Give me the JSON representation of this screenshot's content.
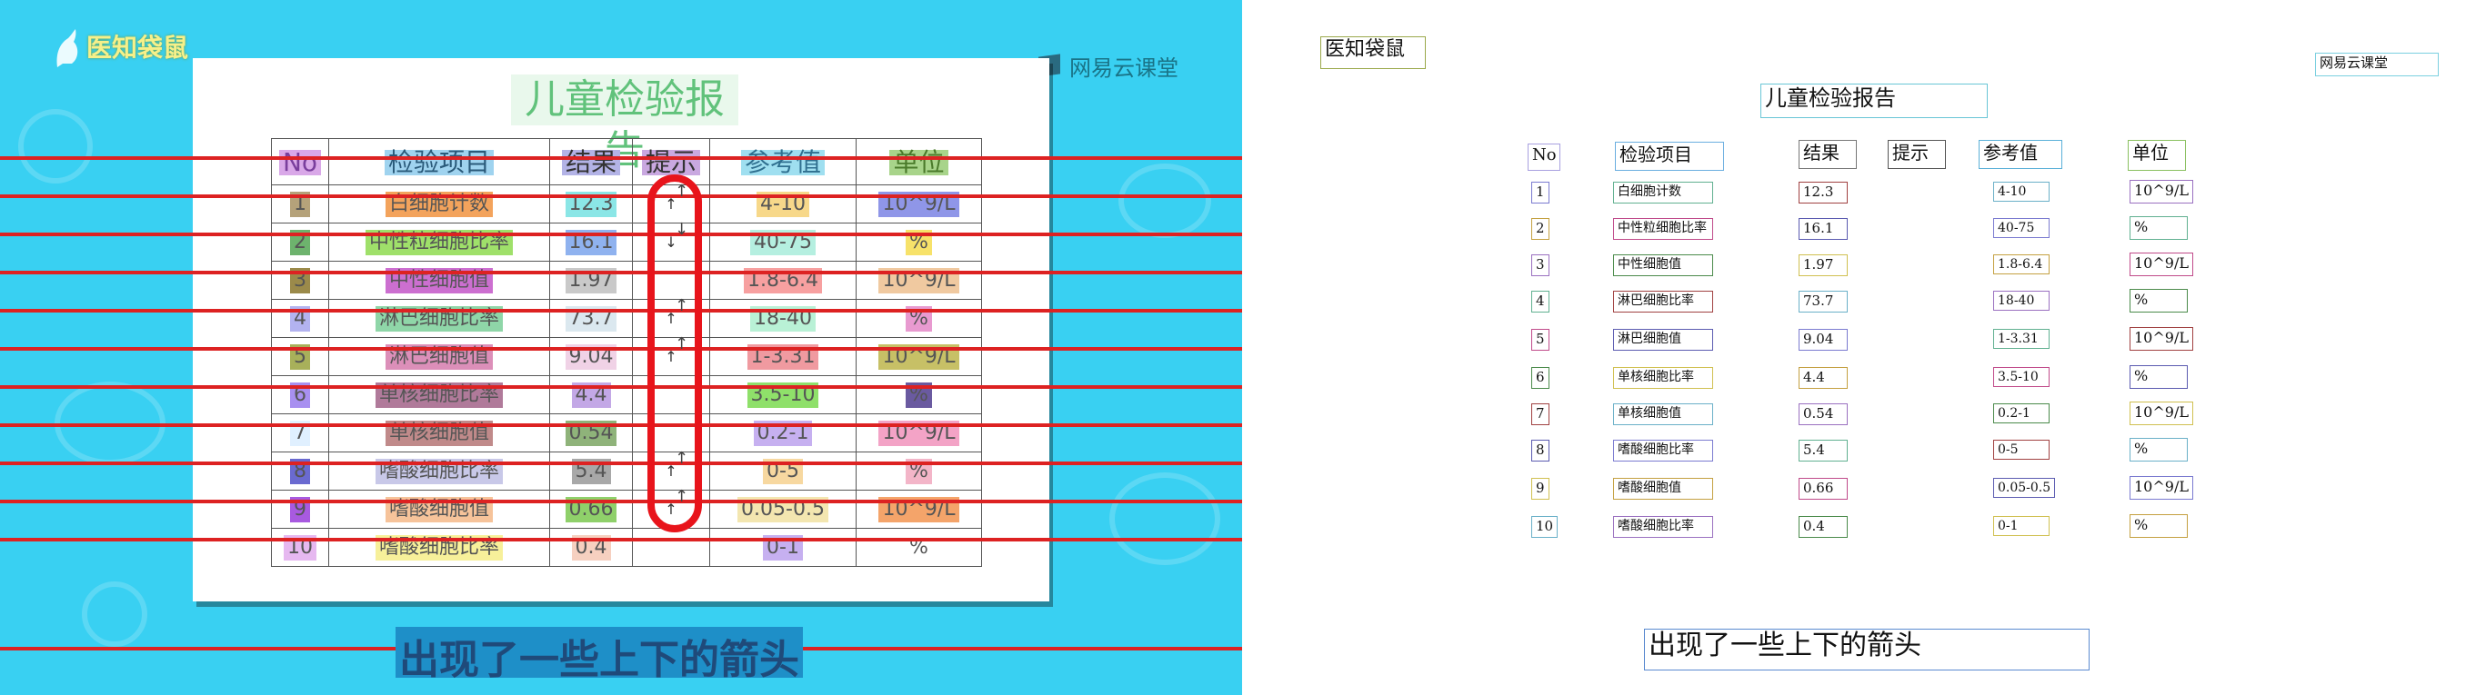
{
  "brand_left": "医知袋鼠",
  "brand_right": "网易云课堂",
  "report_title": "儿童检验报告",
  "columns": [
    "No",
    "检验项目",
    "结果",
    "提示",
    "参考值",
    "单位"
  ],
  "rows": [
    {
      "no": "1",
      "item": "白细胞计数",
      "result": "12.3",
      "ref": "4-10",
      "unit": "10^9/L",
      "flag": "↑"
    },
    {
      "no": "2",
      "item": "中性粒细胞比率",
      "result": "16.1",
      "ref": "40-75",
      "unit": "%",
      "flag": "↓"
    },
    {
      "no": "3",
      "item": "中性细胞值",
      "result": "1.97",
      "ref": "1.8-6.4",
      "unit": "10^9/L",
      "flag": ""
    },
    {
      "no": "4",
      "item": "淋巴细胞比率",
      "result": "73.7",
      "ref": "18-40",
      "unit": "%",
      "flag": "↑"
    },
    {
      "no": "5",
      "item": "淋巴细胞值",
      "result": "9.04",
      "ref": "1-3.31",
      "unit": "10^9/L",
      "flag": "↑"
    },
    {
      "no": "6",
      "item": "单核细胞比率",
      "result": "4.4",
      "ref": "3.5-10",
      "unit": "%",
      "flag": ""
    },
    {
      "no": "7",
      "item": "单核细胞值",
      "result": "0.54",
      "ref": "0.2-1",
      "unit": "10^9/L",
      "flag": ""
    },
    {
      "no": "8",
      "item": "嗜酸细胞比率",
      "result": "5.4",
      "ref": "0-5",
      "unit": "%",
      "flag": "↑"
    },
    {
      "no": "9",
      "item": "嗜酸细胞值",
      "result": "0.66",
      "ref": "0.05-0.5",
      "unit": "10^9/L",
      "flag": "↑"
    },
    {
      "no": "10",
      "item": "嗜酸细胞比率",
      "result": "0.4",
      "ref": "0-1",
      "unit": "%",
      "flag": ""
    }
  ],
  "caption": "出现了一些上下的箭头",
  "colors": {
    "video_background": "#39d0f2",
    "annotation_line": "#dd2222",
    "highlight_oval": "#e8141b",
    "title_green": "#61c27b"
  }
}
